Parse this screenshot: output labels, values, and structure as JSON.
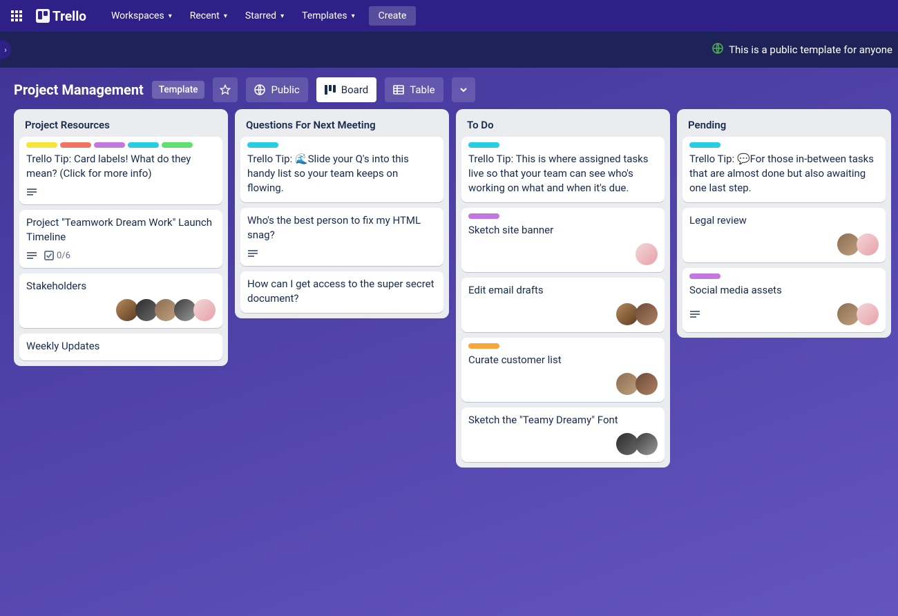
{
  "nav": {
    "items": [
      "Workspaces",
      "Recent",
      "Starred",
      "Templates"
    ],
    "create": "Create",
    "logo": "Trello"
  },
  "notice": {
    "text": "This is a public template for anyone"
  },
  "header": {
    "title": "Project Management",
    "template_badge": "Template",
    "public": "Public",
    "board": "Board",
    "table": "Table"
  },
  "colors": {
    "yellow": "#f5e43a",
    "red": "#ef7564",
    "purple": "#c377e0",
    "sky": "#29cce5",
    "green": "#61e06f",
    "orange": "#faa53d"
  },
  "avatars": [
    "linear-gradient(135deg,#b6895a,#5a3b20)",
    "linear-gradient(135deg,#2b2b2b,#6b6b6b)",
    "linear-gradient(135deg,#8a6d50,#c0a080)",
    "linear-gradient(135deg,#3b3b3b,#9a9a9a)",
    "linear-gradient(135deg,#f2d7d9,#e8a0a8)",
    "linear-gradient(135deg,#6a4a3a,#b08060)"
  ],
  "lists": [
    {
      "title": "Project Resources",
      "cards": [
        {
          "labels": [
            "yellow",
            "red",
            "purple",
            "sky",
            "green"
          ],
          "text": "Trello Tip: Card labels! What do they mean? (Click for more info)",
          "hasDesc": true
        },
        {
          "text": "Project \"Teamwork Dream Work\" Launch Timeline",
          "hasDesc": true,
          "checklist": "0/6"
        },
        {
          "text": "Stakeholders",
          "memberIdx": [
            0,
            1,
            2,
            3,
            4
          ]
        },
        {
          "text": "Weekly Updates"
        }
      ]
    },
    {
      "title": "Questions For Next Meeting",
      "cards": [
        {
          "labels": [
            "sky"
          ],
          "text": "Trello Tip: 🌊Slide your Q's into this handy list so your team keeps on flowing."
        },
        {
          "text": "Who's the best person to fix my HTML snag?",
          "hasDesc": true
        },
        {
          "text": "How can I get access to the super secret document?"
        }
      ]
    },
    {
      "title": "To Do",
      "cards": [
        {
          "labels": [
            "sky"
          ],
          "text": "Trello Tip: This is where assigned tasks live so that your team can see who's working on what and when it's due."
        },
        {
          "labels": [
            "purple"
          ],
          "text": "Sketch site banner",
          "memberIdx": [
            4
          ]
        },
        {
          "text": "Edit email drafts",
          "memberIdx": [
            0,
            5
          ]
        },
        {
          "labels": [
            "orange"
          ],
          "text": "Curate customer list",
          "memberIdx": [
            2,
            5
          ]
        },
        {
          "text": "Sketch the \"Teamy Dreamy\" Font",
          "memberIdx": [
            1,
            3
          ]
        }
      ]
    },
    {
      "title": "Pending",
      "cards": [
        {
          "labels": [
            "sky"
          ],
          "text": "Trello Tip: 💬For those in-between tasks that are almost done but also awaiting one last step."
        },
        {
          "text": "Legal review",
          "memberIdx": [
            2,
            4
          ]
        },
        {
          "labels": [
            "purple"
          ],
          "text": "Social media assets",
          "hasDesc": true,
          "memberIdx": [
            2,
            4
          ]
        }
      ]
    }
  ]
}
